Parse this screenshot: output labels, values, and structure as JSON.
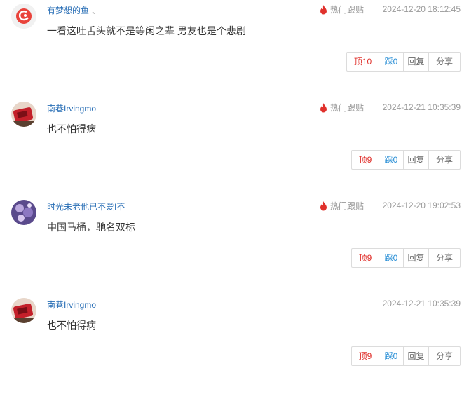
{
  "comments": [
    {
      "username": "有梦想的鱼",
      "username_suffix": "、",
      "hot_label": "热门跟贴",
      "time": "2024-12-20 18:12:45",
      "text": "一看这吐舌头就不是等闲之辈 男友也是个悲剧",
      "up_label": "顶10",
      "down_label": "踩0",
      "reply_label": "回复",
      "share_label": "分享"
    },
    {
      "username": "南巷Irvingmo",
      "hot_label": "热门跟贴",
      "time": "2024-12-21 10:35:39",
      "text": "也不怕得病",
      "up_label": "顶9",
      "down_label": "踩0",
      "reply_label": "回复",
      "share_label": "分享"
    },
    {
      "username": "时光未老他已不爱I不",
      "hot_label": "热门跟贴",
      "time": "2024-12-20 19:02:53",
      "text": "中国马桶，驰名双标",
      "up_label": "顶9",
      "down_label": "踩0",
      "reply_label": "回复",
      "share_label": "分享"
    },
    {
      "username": "南巷Irvingmo",
      "time": "2024-12-21 10:35:39",
      "text": "也不怕得病",
      "up_label": "顶9",
      "down_label": "踩0",
      "reply_label": "回复",
      "share_label": "分享"
    }
  ],
  "colors": {
    "username": "#2a6fb6",
    "hot_icon": "#e0312c",
    "up": "#e0312c",
    "down": "#2a8fd6"
  },
  "icons": {
    "hot": "fire-icon"
  }
}
